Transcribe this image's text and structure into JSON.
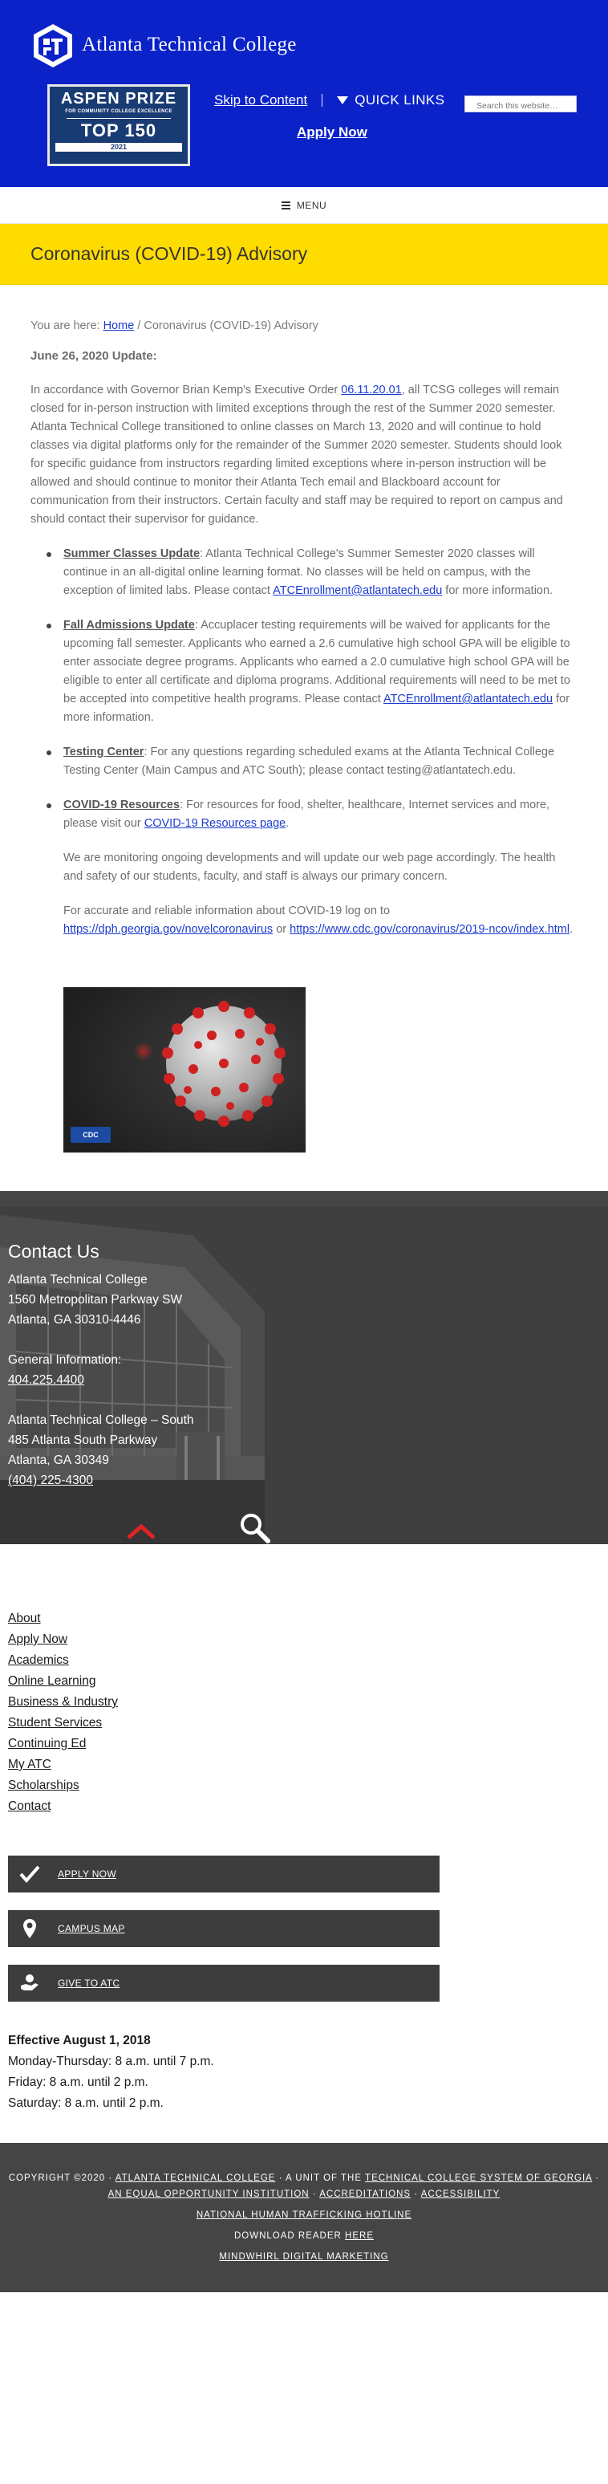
{
  "header": {
    "college_name": "Atlanta Technical College",
    "skip_link": "Skip to Content",
    "quick_links": "QUICK LINKS",
    "search_placeholder": "Search this website…",
    "apply_now": "Apply Now",
    "badge": {
      "title": "ASPEN PRIZE",
      "subtitle": "FOR COMMUNITY COLLEGE EXCELLENCE",
      "ranking": "TOP 150",
      "year": "2021"
    }
  },
  "menu": {
    "label": "MENU"
  },
  "page_title": "Coronavirus (COVID-19) Advisory",
  "breadcrumb": {
    "prefix": "You are here:",
    "home": "Home",
    "separator": "/",
    "current": "Coronavirus (COVID-19) Advisory"
  },
  "content": {
    "update_date": "June 26, 2020 Update:",
    "lead_before": "In accordance with Governor Brian Kemp's Executive Order ",
    "lead_order_link": "06.11.20.01",
    "lead_after": ", all TCSG colleges will remain closed for in-person instruction with limited exceptions through the rest of the Summer 2020 semester. Atlanta Technical College transitioned to online classes on March 13, 2020 and will continue to hold classes via digital platforms only for the remainder of the Summer 2020 semester. Students should look for specific guidance from instructors regarding limited exceptions where in-person instruction will be allowed and should continue to monitor their Atlanta Tech email and Blackboard account for communication from their instructors. Certain faculty and staff may be required to report on campus and should contact their supervisor for guidance.",
    "items": [
      {
        "title": "Summer Classes Update",
        "text": ": Atlanta Technical College's Summer Semester 2020 classes will continue in an all-digital online learning format. No classes will be held on campus, with the exception of limited labs. Please contact ",
        "link": "ATCEnrollment@atlantatech.edu",
        "after": " for more information."
      },
      {
        "title": "Fall Admissions Update",
        "text": ": Accuplacer testing requirements will be waived for applicants for the upcoming fall semester.  Applicants who earned a 2.6 cumulative high school GPA will be eligible to enter associate degree programs.  Applicants who earned a 2.0 cumulative high school GPA will be eligible to enter all certificate and diploma programs. Additional requirements will need to be met to be accepted into competitive health programs.  Please contact ",
        "link": "ATCEnrollment@atlantatech.edu",
        "after": " for more information."
      },
      {
        "title": "Testing Center",
        "text": ": For any questions regarding scheduled exams at the Atlanta Technical College Testing Center (Main Campus and ATC South); please contact testing@atlantatech.edu.",
        "link": "",
        "after": ""
      },
      {
        "title": "COVID-19 Resources",
        "text": ": For resources for food, shelter, healthcare, Internet services and more, please visit our ",
        "link": "COVID-19 Resources page",
        "after": "."
      }
    ],
    "monitoring": "We are monitoring ongoing developments and will update our web page accordingly. The health and safety of our students, faculty, and staff is always our primary concern.",
    "info_before": "For accurate and reliable information about COVID-19 log on to ",
    "info_link_1": "https://dph.georgia.gov/novelcoronavirus",
    "info_or": " or ",
    "info_link_2": "https://www.cdc.gov/coronavirus/2019-ncov/index.html",
    "info_after": ".",
    "image_badge": "CDC"
  },
  "contact": {
    "heading": "Contact Us",
    "main_name": "Atlanta Technical College",
    "main_street": "1560 Metropolitan Parkway SW",
    "main_city": "Atlanta, GA 30310-4446",
    "general_label": "General Information:",
    "general_phone": "404.225.4400",
    "south_name": "Atlanta Technical College – South",
    "south_street": "485 Atlanta South Parkway",
    "south_city": "Atlanta, GA 30349",
    "south_phone": "(404) 225-4300"
  },
  "footer_nav": [
    "About",
    "Apply Now",
    "Academics",
    "Online Learning",
    "Business & Industry",
    "Student Services",
    "Continuing Ed",
    "My ATC",
    "Scholarships",
    "Contact"
  ],
  "action_buttons": {
    "apply": "APPLY NOW",
    "map": "CAMPUS MAP",
    "give": "GIVE TO ATC"
  },
  "hours": {
    "title": "Effective August 1, 2018",
    "weekday": "Monday-Thursday: 8 a.m. until 7 p.m.",
    "friday": "Friday: 8 a.m. until 2 p.m.",
    "saturday": "Saturday: 8 a.m. until 2 p.m."
  },
  "copyright": {
    "prefix": "COPYRIGHT ©2020 ·",
    "college_link": "ATLANTA TECHNICAL COLLEGE",
    "unit_of": "· A UNIT OF THE",
    "tcsg_link": "TECHNICAL COLLEGE SYSTEM OF GEORGIA",
    "dot": "·",
    "equal_opportunity": "AN EQUAL OPPORTUNITY INSTITUTION",
    "accreditations": "ACCREDITATIONS",
    "accessibility": "ACCESSIBILITY",
    "trafficking": "NATIONAL HUMAN TRAFFICKING HOTLINE",
    "download_prefix": "DOWNLOAD READER",
    "download_link": "HERE",
    "agency": "MINDWHIRL DIGITAL MARKETING"
  }
}
